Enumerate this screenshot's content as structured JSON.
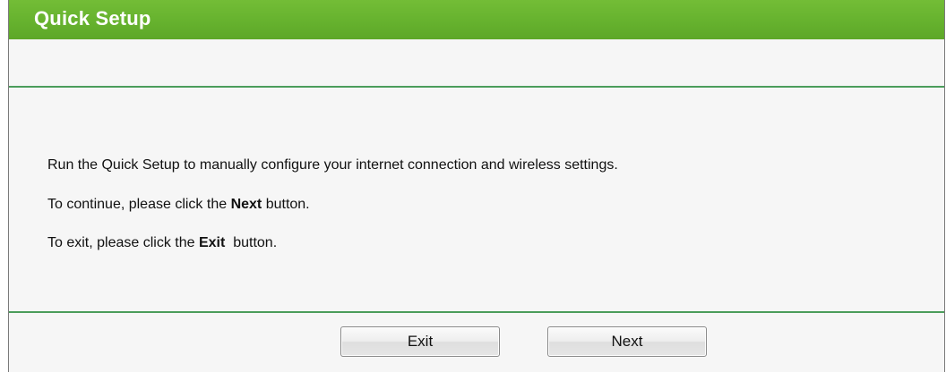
{
  "header": {
    "title": "Quick Setup"
  },
  "message": {
    "line1": "Run the Quick Setup to manually configure your internet connection and wireless settings.",
    "line2_prefix": "To continue, please click the ",
    "line2_bold": "Next",
    "line2_suffix": " button.",
    "line3_prefix": "To exit, please click the ",
    "line3_bold": "Exit",
    "line3_suffix": "  button."
  },
  "buttons": {
    "exit_label": "Exit",
    "next_label": "Next"
  },
  "colors": {
    "header_green": "#66b22e",
    "divider_green": "#4b9d5b",
    "panel_background": "#f6f6f6"
  }
}
